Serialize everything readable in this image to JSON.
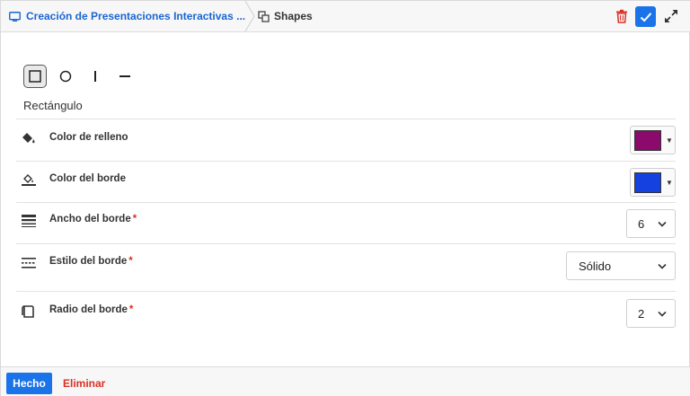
{
  "header": {
    "breadcrumb_presentation": "Creación de Presentaciones Interactivas ...",
    "breadcrumb_current": "Shapes"
  },
  "shapes": {
    "options": [
      {
        "name": "rectangle",
        "icon": "square-icon",
        "selected": true
      },
      {
        "name": "circle",
        "icon": "circle-icon",
        "selected": false
      },
      {
        "name": "vertical-line",
        "icon": "vertical-line-icon",
        "selected": false
      },
      {
        "name": "horizontal-line",
        "icon": "horizontal-line-icon",
        "selected": false
      }
    ],
    "selected_label": "Rectángulo"
  },
  "properties": {
    "fill_color": {
      "label": "Color de relleno",
      "value": "#8b0a6b",
      "icon": "paint-bucket-icon"
    },
    "border_color": {
      "label": "Color del borde",
      "value": "#1541e0",
      "icon": "border-color-icon"
    },
    "border_width": {
      "label": "Ancho del borde",
      "required": "*",
      "value": "6",
      "icon": "line-weight-icon"
    },
    "border_style": {
      "label": "Estilo del borde",
      "required": "*",
      "value": "Sólido",
      "icon": "line-style-icon"
    },
    "border_radius": {
      "label": "Radio del borde",
      "required": "*",
      "value": "2",
      "icon": "rounded-corner-icon"
    }
  },
  "footer": {
    "done_label": "Hecho",
    "delete_label": "Eliminar"
  },
  "colors": {
    "accent": "#1a73e8",
    "danger": "#d93025"
  }
}
